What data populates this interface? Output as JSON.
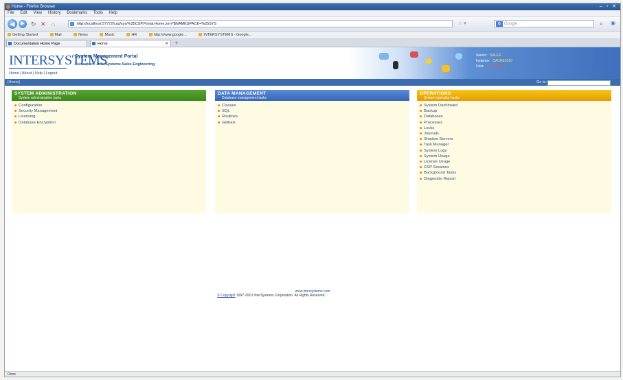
{
  "window": {
    "title": "Home - Firefox Browser"
  },
  "menubar": [
    "File",
    "Edit",
    "View",
    "History",
    "Bookmarks",
    "Tools",
    "Help"
  ],
  "navbar": {
    "url": "http://localhost:57772/csp/sys/%25CSP.Portal.Home.zen?$NAMESPACE=%25SYS",
    "search_placeholder": "Google"
  },
  "bookmarks": [
    "Getting Started",
    "Mail",
    "News",
    "Music",
    "HR",
    "http://www.google...",
    "INTERSYSTEMS - Google..."
  ],
  "tabs": [
    {
      "label": "Documentation Home Page"
    },
    {
      "label": "Home"
    }
  ],
  "portal": {
    "logo": "INTERSYSTEMS",
    "title": "System Management Portal",
    "namespace_label": "Namespace:",
    "namespace_value": "InterSystems Sales Engineering",
    "links": "Home | About | Help | Logout",
    "server_label": "Server:",
    "server_value": "SALES",
    "instance_label": "Instance:",
    "instance_value": "CACHE2010",
    "user_label": "User:",
    "user_value": "_SYSTEM"
  },
  "breadcrumb": "[Home]",
  "goto_label": "Go to:",
  "panels": {
    "admin": {
      "title": "System Administration",
      "subtitle": "System administration tasks",
      "items": [
        "Configuration",
        "Security Management",
        "Licensing",
        "Database Encryption"
      ]
    },
    "data": {
      "title": "Data Management",
      "subtitle": "Database management tasks",
      "items": [
        "Classes",
        "SQL",
        "Routines",
        "Globals"
      ]
    },
    "ops": {
      "title": "Operations",
      "subtitle": "System operation tasks",
      "items": [
        "System Dashboard",
        "Backup",
        "Databases",
        "Processes",
        "Locks",
        "Journals",
        "Shadow Servers",
        "Task Manager",
        "System Logs",
        "System Usage",
        "License Usage",
        "CSP Sessions",
        "Background Tasks",
        "Diagnostic Report"
      ]
    }
  },
  "footer": {
    "site": "www.intersystems.com",
    "copyright_link": "© Copyright",
    "copyright_text": "1997-2010 InterSystems Corporation. All Rights Reserved."
  },
  "status": "Done",
  "colors": {
    "admin": "#4a9a28",
    "data": "#4a7ccc",
    "ops": "#f2b50c",
    "panel_bg": "#fffbe3"
  }
}
